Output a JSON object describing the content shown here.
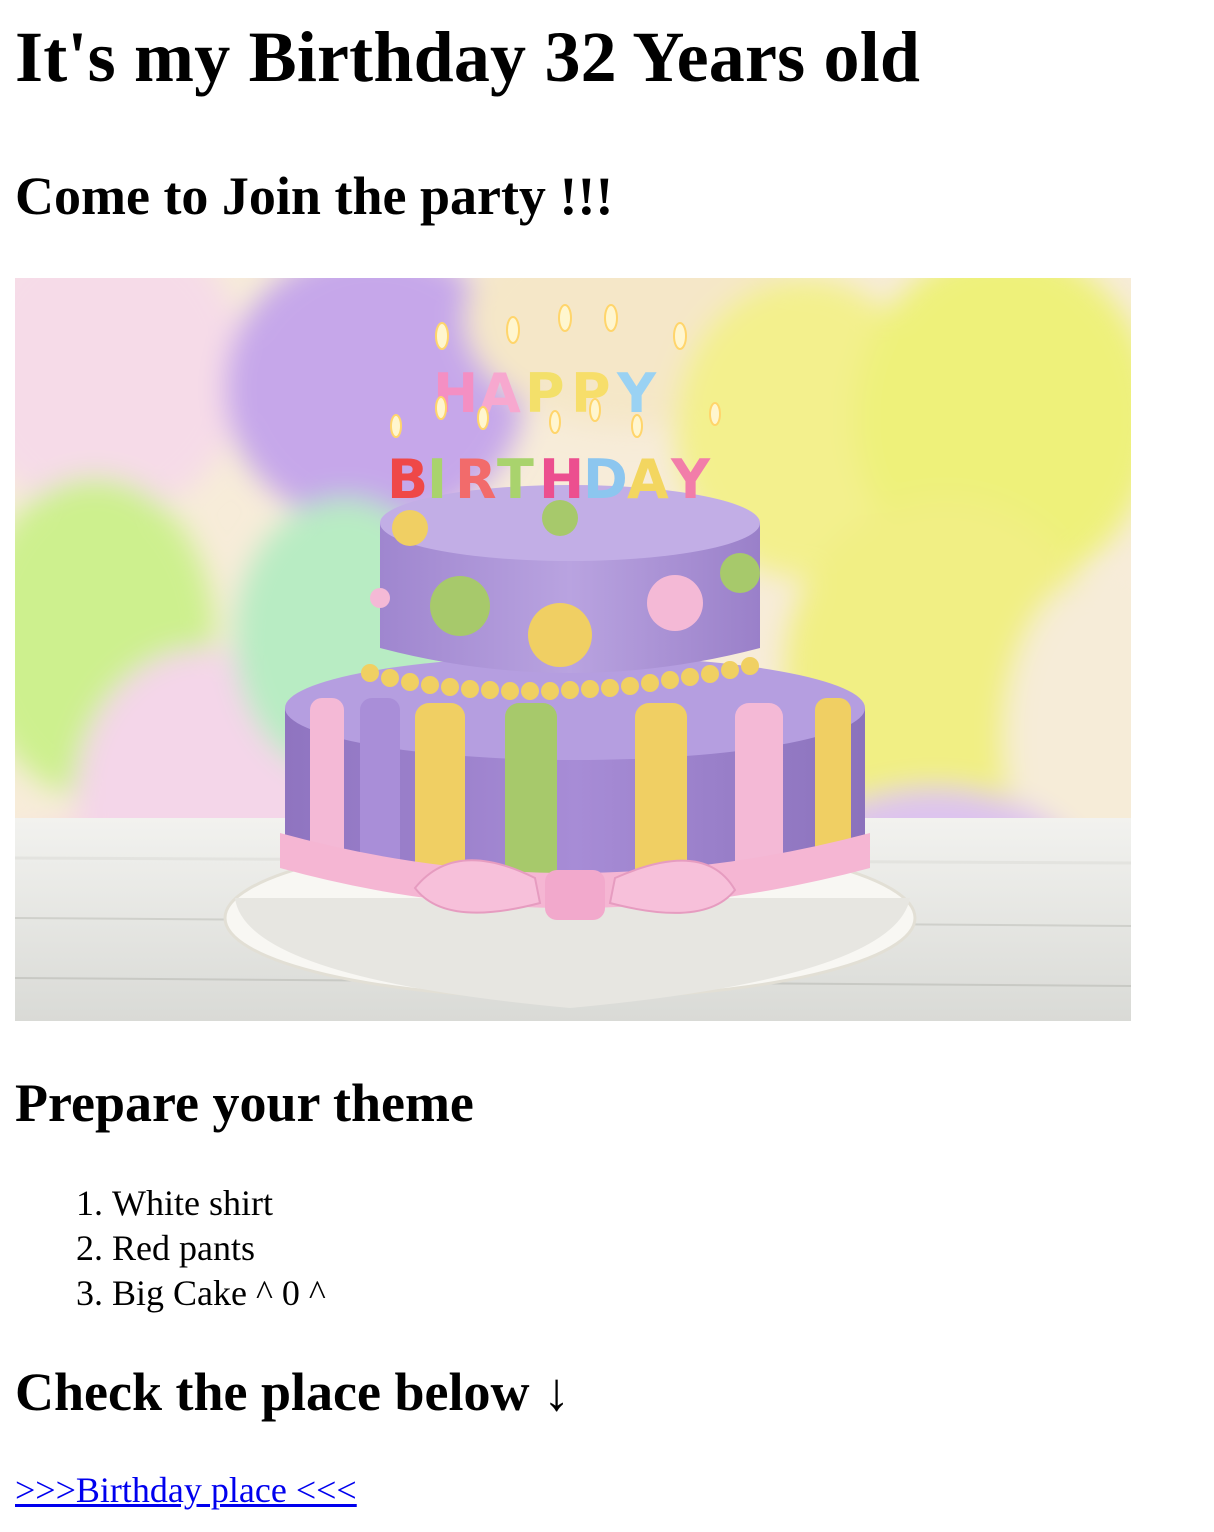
{
  "page": {
    "title": "It's my Birthday 32 Years old",
    "subtitle": "Come to Join the party !!!",
    "image": {
      "depicts": "two-tier purple birthday cake",
      "candles_text": [
        "HAPPY",
        "BIRTHDAY"
      ],
      "colors": {
        "cake_purple": "#a98fd4",
        "ribbon_pink": "#f3b8d4",
        "stripe_yellow": "#f0cf63",
        "stripe_green": "#a7c96b",
        "balloon_yellow": "#eef07a"
      }
    },
    "theme_heading": "Prepare your theme",
    "theme_items": [
      "White shirt",
      "Red pants",
      "Big Cake ^ 0 ^"
    ],
    "place_heading": "Check the place below ↓",
    "place_link_text": ">>>Birthday place <<<"
  },
  "colors": {
    "link": "#0000ee",
    "text": "#000000",
    "background": "#ffffff"
  }
}
